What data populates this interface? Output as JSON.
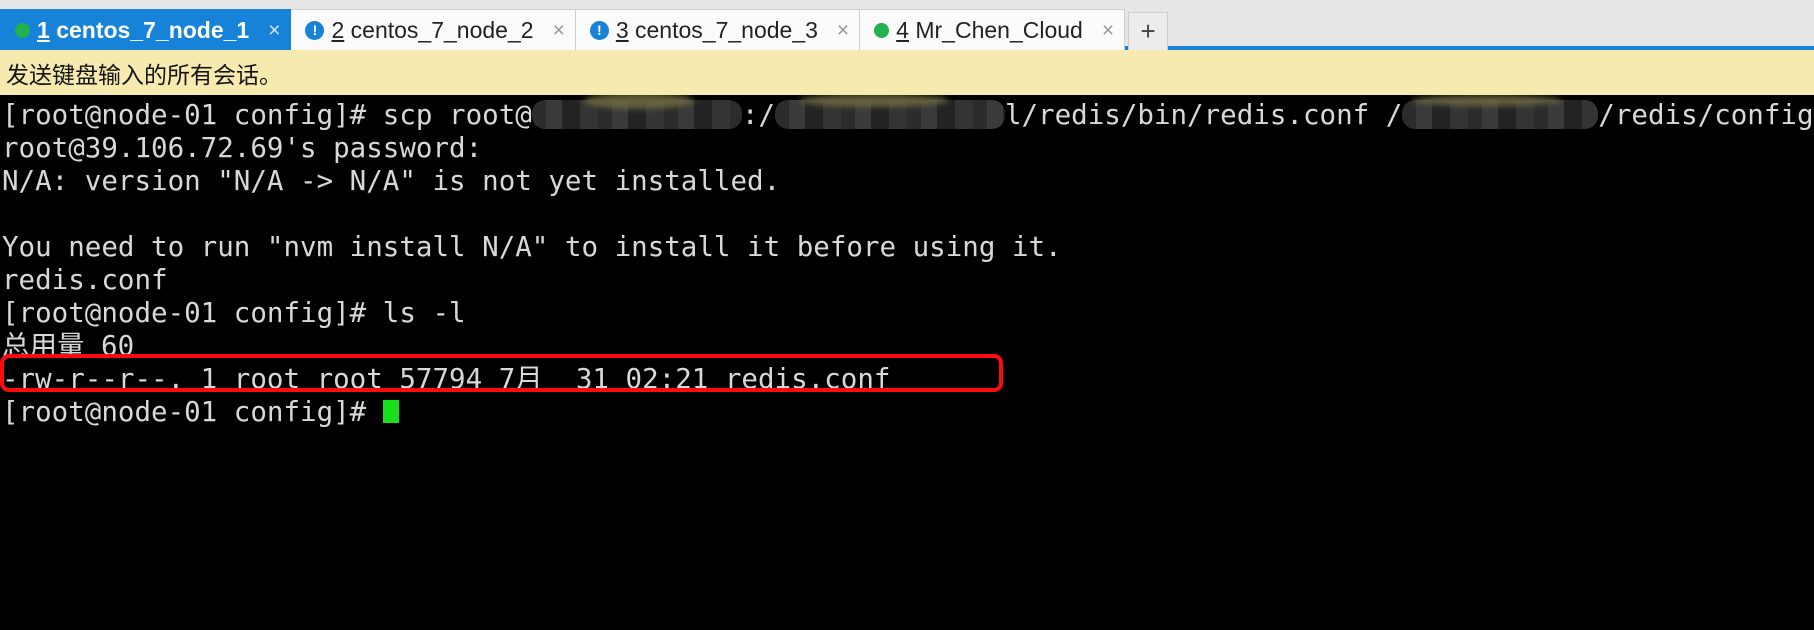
{
  "window": {
    "accent_color": "#1683d8",
    "tabstrip_bg": "#e6e6e6"
  },
  "tabs": [
    {
      "index": "1",
      "label": "centos_7_node_1",
      "full_label": "1 centos_7_node_1",
      "status_icon": "green-dot-icon",
      "active": true,
      "close_glyph": "×"
    },
    {
      "index": "2",
      "label": "centos_7_node_2",
      "full_label": "2 centos_7_node_2",
      "status_icon": "blue-alert-icon",
      "active": false,
      "close_glyph": "×"
    },
    {
      "index": "3",
      "label": "centos_7_node_3",
      "full_label": "3 centos_7_node_3",
      "status_icon": "blue-alert-icon",
      "active": false,
      "close_glyph": "×"
    },
    {
      "index": "4",
      "label": "Mr_Chen_Cloud",
      "full_label": "4 Mr_Chen_Cloud",
      "status_icon": "green-dot-icon",
      "active": false,
      "close_glyph": "×"
    }
  ],
  "new_tab": {
    "label": "+",
    "icon": "plus-icon"
  },
  "notice": {
    "text": "发送键盘输入的所有会话。",
    "background": "#f7eaae"
  },
  "terminal": {
    "foreground": "#d8d8d8",
    "background": "#000000",
    "cursor_color": "#15e01b",
    "annotation_color": "#fc0d0d",
    "lines": [
      {
        "id": "line-scp-command",
        "segments": [
          {
            "kind": "text",
            "value": "[root@node-01 config]# scp root@"
          },
          {
            "kind": "redact",
            "value": ""
          },
          {
            "kind": "text",
            "value": ":/"
          },
          {
            "kind": "redact",
            "value": ""
          },
          {
            "kind": "text",
            "value": "l/redis/bin/redis.conf /"
          },
          {
            "kind": "redact",
            "value": ""
          },
          {
            "kind": "text",
            "value": "/redis/config/"
          }
        ]
      },
      {
        "id": "line-password-prompt",
        "text": "root@39.106.72.69's password:"
      },
      {
        "id": "line-nvm-version",
        "text": "N/A: version \"N/A -> N/A\" is not yet installed."
      },
      {
        "id": "line-blank-1",
        "text": ""
      },
      {
        "id": "line-nvm-hint",
        "text": "You need to run \"nvm install N/A\" to install it before using it."
      },
      {
        "id": "line-scp-result",
        "text": "redis.conf"
      },
      {
        "id": "line-ls-command",
        "text": "[root@node-01 config]# ls -l"
      },
      {
        "id": "line-total",
        "text": "总用量 60"
      },
      {
        "id": "line-file-entry",
        "text": "-rw-r--r--. 1 root root 57794 7月  31 02:21 redis.conf",
        "highlighted": true
      },
      {
        "id": "line-final-prompt",
        "text": "[root@node-01 config]# ",
        "cursor": true
      }
    ]
  }
}
